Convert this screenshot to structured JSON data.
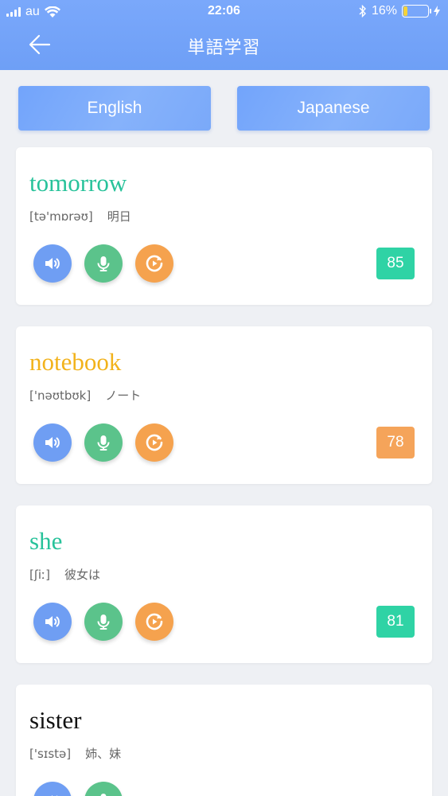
{
  "status_bar": {
    "carrier": "au",
    "time": "22:06",
    "battery_percent": "16%",
    "battery_level": 0.16
  },
  "header": {
    "title": "単語学習"
  },
  "tabs": [
    {
      "label": "English"
    },
    {
      "label": "Japanese"
    }
  ],
  "colors": {
    "header": "#7aa8fb",
    "speak_button": "#6f9ef3",
    "record_button": "#5bc38b",
    "play_button": "#f5a24e",
    "score_green": "#2fd3a5",
    "score_orange": "#f5a45a"
  },
  "icons": {
    "back": "arrow-left-icon",
    "speak": "speaker-icon",
    "record": "microphone-icon",
    "play": "replay-icon"
  },
  "cards": [
    {
      "word": "tomorrow",
      "phonetic": "[tə'mɒrəʊ]",
      "meaning": "明日",
      "score": "85",
      "word_color": "#27c29a",
      "score_color": "#2fd3a5"
    },
    {
      "word": "notebook",
      "phonetic": "['nəʊtbʊk]",
      "meaning": "ノート",
      "score": "78",
      "word_color": "#f2b21b",
      "score_color": "#f5a45a"
    },
    {
      "word": "she",
      "phonetic": "[ʃiː]",
      "meaning": "彼女は",
      "score": "81",
      "word_color": "#27c29a",
      "score_color": "#2fd3a5"
    },
    {
      "word": "sister",
      "phonetic": "['sɪstə]",
      "meaning": "姉、妹",
      "score": "",
      "word_color": "#111111",
      "score_color": "#2fd3a5"
    }
  ]
}
